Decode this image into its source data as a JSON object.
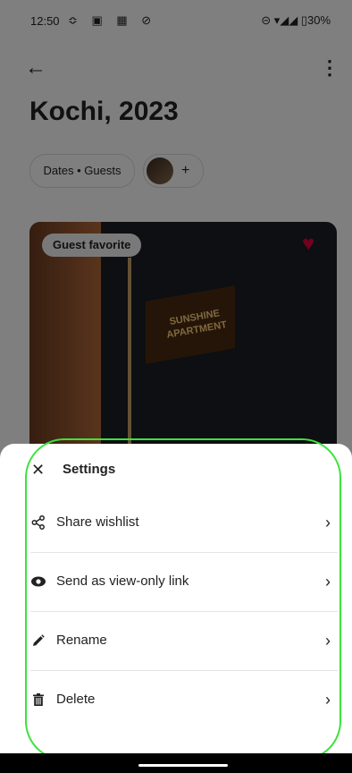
{
  "status_bar": {
    "time": "12:50",
    "left_icons": "≎ ▣ ▦ ⊘",
    "right": "⊝ ▾◢◢ ▯30%"
  },
  "header": {
    "back_icon": "←",
    "more_icon": "⋮",
    "title": "Kochi, 2023"
  },
  "filters": {
    "dates_guests": "Dates • Guests",
    "plus": "+"
  },
  "listing": {
    "badge": "Guest favorite",
    "sign_line1": "SUNSHINE",
    "sign_line2": "APARTMENT"
  },
  "sheet": {
    "title": "Settings",
    "close_icon": "✕",
    "items": [
      {
        "label": "Share wishlist",
        "icon": "share-icon"
      },
      {
        "label": "Send as view-only link",
        "icon": "eye-icon"
      },
      {
        "label": "Rename",
        "icon": "pencil-icon"
      },
      {
        "label": "Delete",
        "icon": "trash-icon"
      }
    ],
    "chevron": "›"
  }
}
